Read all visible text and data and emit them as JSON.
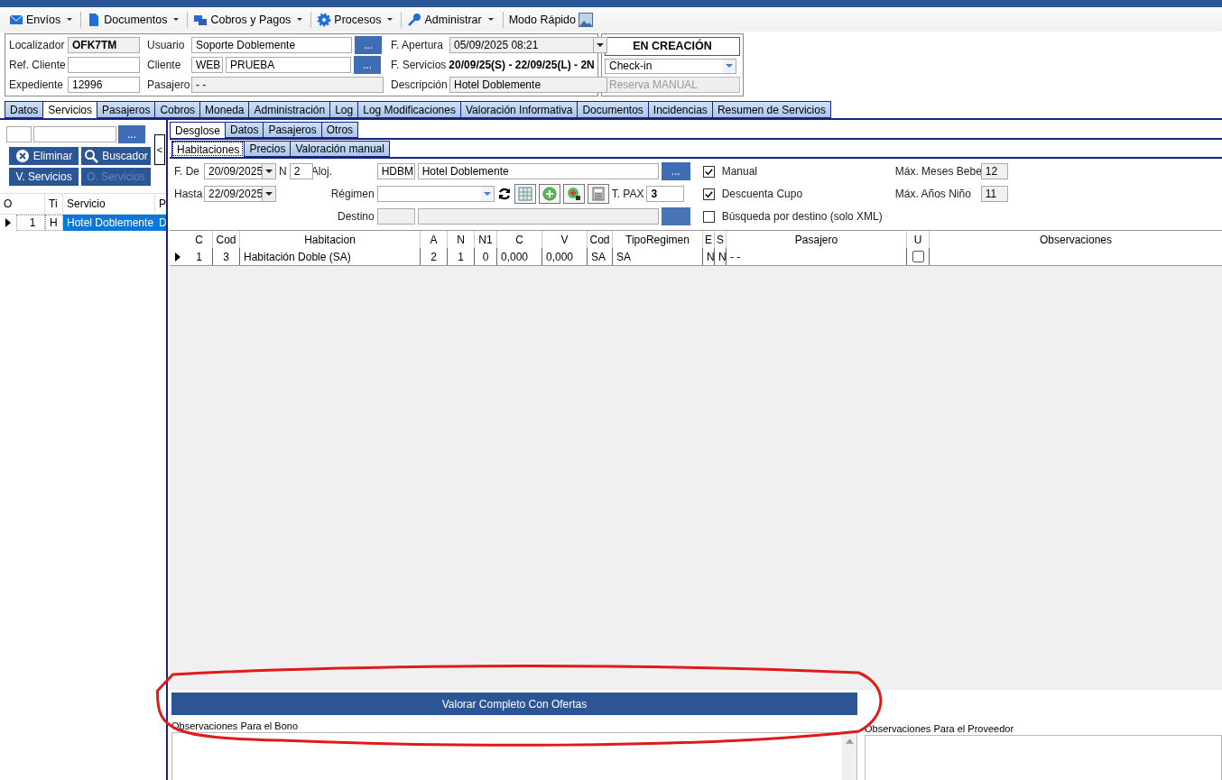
{
  "toolbar": [
    {
      "label": "Envíos",
      "kind": "menu"
    },
    {
      "label": "Documentos",
      "kind": "menu"
    },
    {
      "label": "Cobros y Pagos",
      "kind": "menu"
    },
    {
      "label": "Procesos",
      "kind": "menu"
    },
    {
      "label": "Administrar",
      "kind": "menu"
    },
    {
      "label": "Modo Rápido",
      "kind": "plain"
    }
  ],
  "header": {
    "localizador_label": "Localizador",
    "localizador": "OFK7TM",
    "ref_cliente_label": "Ref. Cliente",
    "expediente_label": "Expediente",
    "expediente": "12996",
    "usuario_label": "Usuario",
    "usuario": "Soporte Doblemente",
    "cliente_label": "Cliente",
    "cliente_code": "WEB",
    "cliente": "PRUEBA",
    "pasajero_label": "Pasajero",
    "pasajero": "- -",
    "browse": "...",
    "f_apertura_label": "F. Apertura",
    "f_apertura": "05/09/2025 08:21",
    "f_servicios_label": "F.  Servicios",
    "f_servicios": "20/09/25(S) - 22/09/25(L) - 2N",
    "descripcion_label": "Descripción",
    "descripcion": "Hotel Doblemente",
    "status": "EN CREACIÓN",
    "checkin": "Check-in",
    "reserva_manual": "Reserva MANUAL",
    "reserva_manual_disabled": true
  },
  "main_tabs": [
    {
      "label": "Datos",
      "selected": false
    },
    {
      "label": "Servicios",
      "selected": true
    },
    {
      "label": "Pasajeros",
      "selected": false
    },
    {
      "label": "Cobros",
      "selected": false
    },
    {
      "label": "Moneda",
      "selected": false
    },
    {
      "label": "Administración",
      "selected": false
    },
    {
      "label": "Log",
      "selected": false
    },
    {
      "label": "Log Modificaciones",
      "selected": false
    },
    {
      "label": "Valoración Informativa",
      "selected": false
    },
    {
      "label": "Documentos",
      "selected": false
    },
    {
      "label": "Incidencias",
      "selected": false
    },
    {
      "label": "Resumen de Servicios",
      "selected": false
    }
  ],
  "left": {
    "browse": "...",
    "collapse": "<",
    "buttons": [
      {
        "label": "Eliminar",
        "disabled": false
      },
      {
        "label": "Buscador",
        "disabled": false
      },
      {
        "label": "V. Servicios",
        "disabled": false
      },
      {
        "label": "O. Servicios",
        "disabled": true
      }
    ],
    "columns": [
      "O",
      "Ti",
      "Servicio",
      "P"
    ],
    "rows": [
      {
        "o": "1",
        "ti": "H",
        "servicio": "Hotel Doblemente",
        "p": "D",
        "selected": true
      }
    ]
  },
  "sub_tabs": [
    {
      "label": "Desglose",
      "selected": true
    },
    {
      "label": "Datos",
      "selected": false
    },
    {
      "label": "Pasajeros",
      "selected": false
    },
    {
      "label": "Otros",
      "selected": false
    }
  ],
  "inner_tabs": [
    {
      "label": "Habitaciones",
      "selected": true
    },
    {
      "label": "Precios",
      "selected": false
    },
    {
      "label": "Valoración manual",
      "selected": false
    }
  ],
  "form": {
    "f_de_label": "F. De",
    "f_de": "20/09/2025",
    "n_label": "N",
    "n": "2",
    "hasta_label": "Hasta",
    "hasta": "22/09/2025",
    "aloj_label": "Aloj.",
    "aloj_code": "HDBM",
    "aloj": "Hotel Doblemente",
    "browse": "...",
    "regimen_label": "Régimen",
    "destino_label": "Destino",
    "tpax_label": "T. PAX",
    "tpax": "3",
    "checks": [
      {
        "label": "Manual",
        "checked": true
      },
      {
        "label": "Descuenta Cupo",
        "checked": true
      },
      {
        "label": "Búsqueda por destino (solo XML)",
        "checked": false
      }
    ],
    "meses_bebe_label": "Máx. Meses Bebe",
    "meses_bebe": "12",
    "anos_nino_label": "Máx. Años Niño",
    "anos_nino": "11"
  },
  "grid": {
    "columns": [
      "C",
      "Cod",
      "Habitacion",
      "A",
      "N",
      "N1",
      "C",
      "V",
      "Cod",
      "TipoRegimen",
      "E",
      "S",
      "Pasajero",
      "U",
      "Observaciones"
    ],
    "rows": [
      {
        "cells": [
          "1",
          "3",
          "Habitación Doble (SA)",
          "2",
          "1",
          "0",
          "0,000",
          "0,000",
          "SA",
          "SA",
          "N",
          "N",
          "- -"
        ],
        "u": false
      }
    ]
  },
  "action": "Valorar Completo Con Ofertas",
  "bono_label": "Observaciones Para el Bono",
  "proveedor_label": "Observaciones Para el Proveedor"
}
